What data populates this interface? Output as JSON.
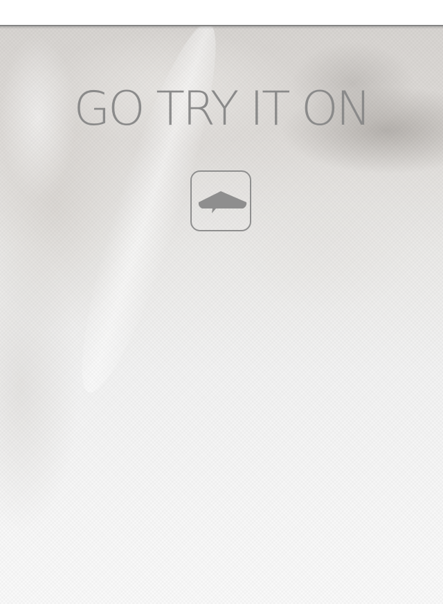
{
  "headline": {
    "text": "GO TRY IT ON"
  },
  "up_button": {
    "icon": "up-arrow-icon"
  },
  "colors": {
    "text": "#8a8a8a",
    "icon": "#8e8e8e",
    "top_bar": "#ffffff"
  }
}
